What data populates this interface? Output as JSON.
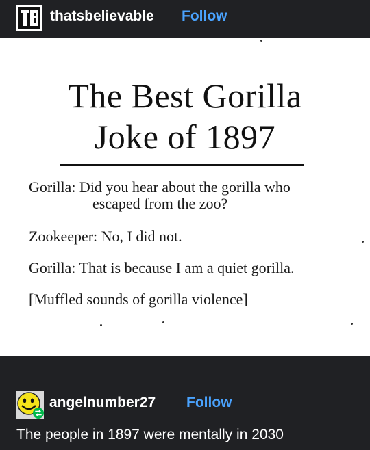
{
  "post": {
    "username": "thatsbelievable",
    "follow_label": "Follow",
    "avatar_icon": "tb-logo-icon"
  },
  "clipping": {
    "title_line1": "The Best Gorilla",
    "title_line2": "Joke of 1897",
    "line1": "Gorilla: Did you hear about the gorilla who",
    "line2": "escaped from the zoo?",
    "line3": "Zookeeper: No, I did not.",
    "line4": "Gorilla: That is because I am a quiet gorilla.",
    "line5": "[Muffled sounds of gorilla violence]"
  },
  "reblog": {
    "username": "angelnumber27",
    "follow_label": "Follow",
    "avatar_icon": "smiley-face-icon",
    "badge_icon": "reblog-icon",
    "comment": "The people in 1897 were mentally in 2030"
  },
  "colors": {
    "background": "#202124",
    "link": "#4aa3ff",
    "text": "#ffffff"
  }
}
